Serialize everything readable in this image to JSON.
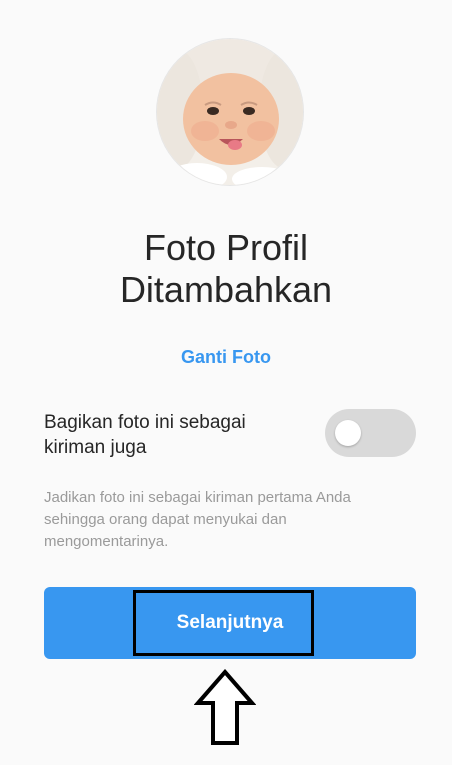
{
  "profile": {
    "avatar_icon": "baby-photo-avatar"
  },
  "confirmation": {
    "title_line1": "Foto Profil",
    "title_line2": "Ditambahkan",
    "change_photo_label": "Ganti Foto"
  },
  "share_option": {
    "label_line1": "Bagikan foto ini sebagai",
    "label_line2": "kiriman juga",
    "enabled": false,
    "helper_line1": "Jadikan foto ini sebagai kiriman pertama Anda",
    "helper_line2": "sehingga orang dapat menyukai dan",
    "helper_line3": "mengomentarinya."
  },
  "actions": {
    "next_label": "Selanjutnya"
  },
  "annotation": {
    "arrow_icon": "up-arrow-icon",
    "highlight": "next-button"
  },
  "colors": {
    "accent": "#3897f0",
    "background": "#fafafa",
    "toggle_off": "#d9d9d9",
    "helper_text": "#9a9a9a"
  }
}
